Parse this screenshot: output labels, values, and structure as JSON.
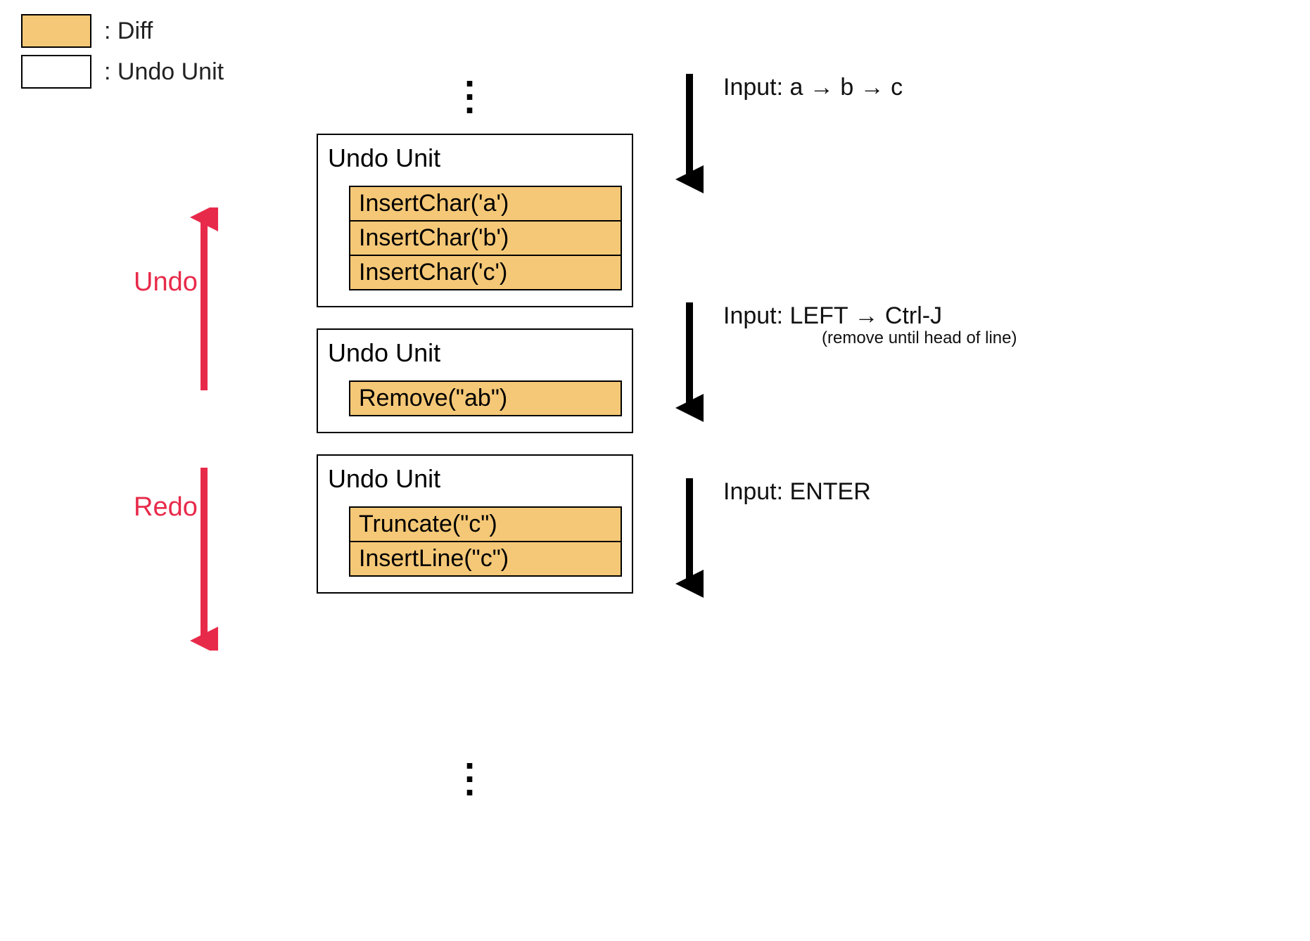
{
  "legend": {
    "diff_label": ": Diff",
    "unit_label": ": Undo Unit"
  },
  "colors": {
    "diff_bg": "#f5c877",
    "unit_bg": "#ffffff",
    "undo_redo": "#e82a4a",
    "arrow_black": "#000000"
  },
  "undo_redo": {
    "undo_label": "Undo",
    "redo_label": "Redo"
  },
  "units": [
    {
      "title": "Undo Unit",
      "diffs": [
        "InsertChar('a')",
        "InsertChar('b')",
        "InsertChar('c')"
      ]
    },
    {
      "title": "Undo Unit",
      "diffs": [
        "Remove(\"ab\")"
      ]
    },
    {
      "title": "Undo Unit",
      "diffs": [
        "Truncate(\"c\")",
        "InsertLine(\"c\")"
      ]
    }
  ],
  "inputs": [
    {
      "text": "Input: a → b → c",
      "sub": ""
    },
    {
      "text": "Input: LEFT → Ctrl-J",
      "sub": "(remove until head of line)"
    },
    {
      "text": "Input: ENTER",
      "sub": ""
    }
  ]
}
